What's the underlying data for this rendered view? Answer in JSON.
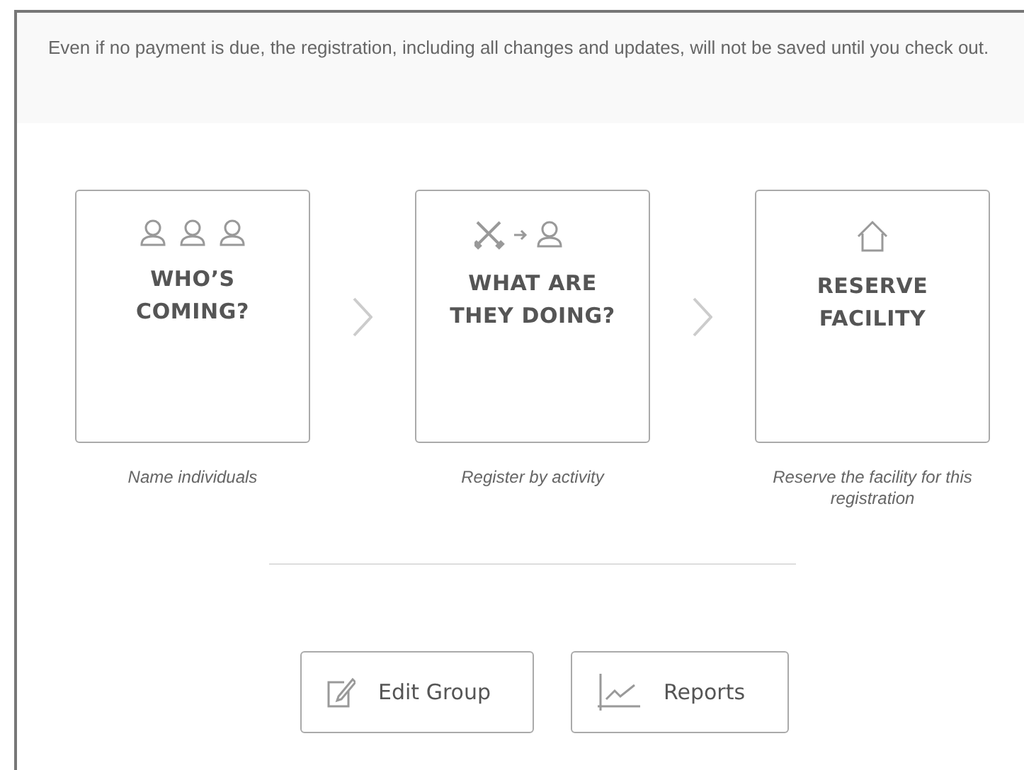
{
  "notice": "Even if no payment is due, the registration, including all changes and updates, will not be saved until you check out.",
  "steps": [
    {
      "kind": "people",
      "title_lines": [
        "WHO’S",
        "COMING?"
      ],
      "caption": "Name individuals"
    },
    {
      "kind": "activity",
      "title_lines": [
        "WHAT ARE",
        "THEY DOING?"
      ],
      "caption": "Register by activity"
    },
    {
      "kind": "facility",
      "title_lines": [
        "RESERVE",
        "FACILITY"
      ],
      "caption": "Reserve the facility for this registration"
    }
  ],
  "buttons": [
    {
      "kind": "edit",
      "label": "Edit Group"
    },
    {
      "kind": "reports",
      "label": "Reports"
    }
  ]
}
